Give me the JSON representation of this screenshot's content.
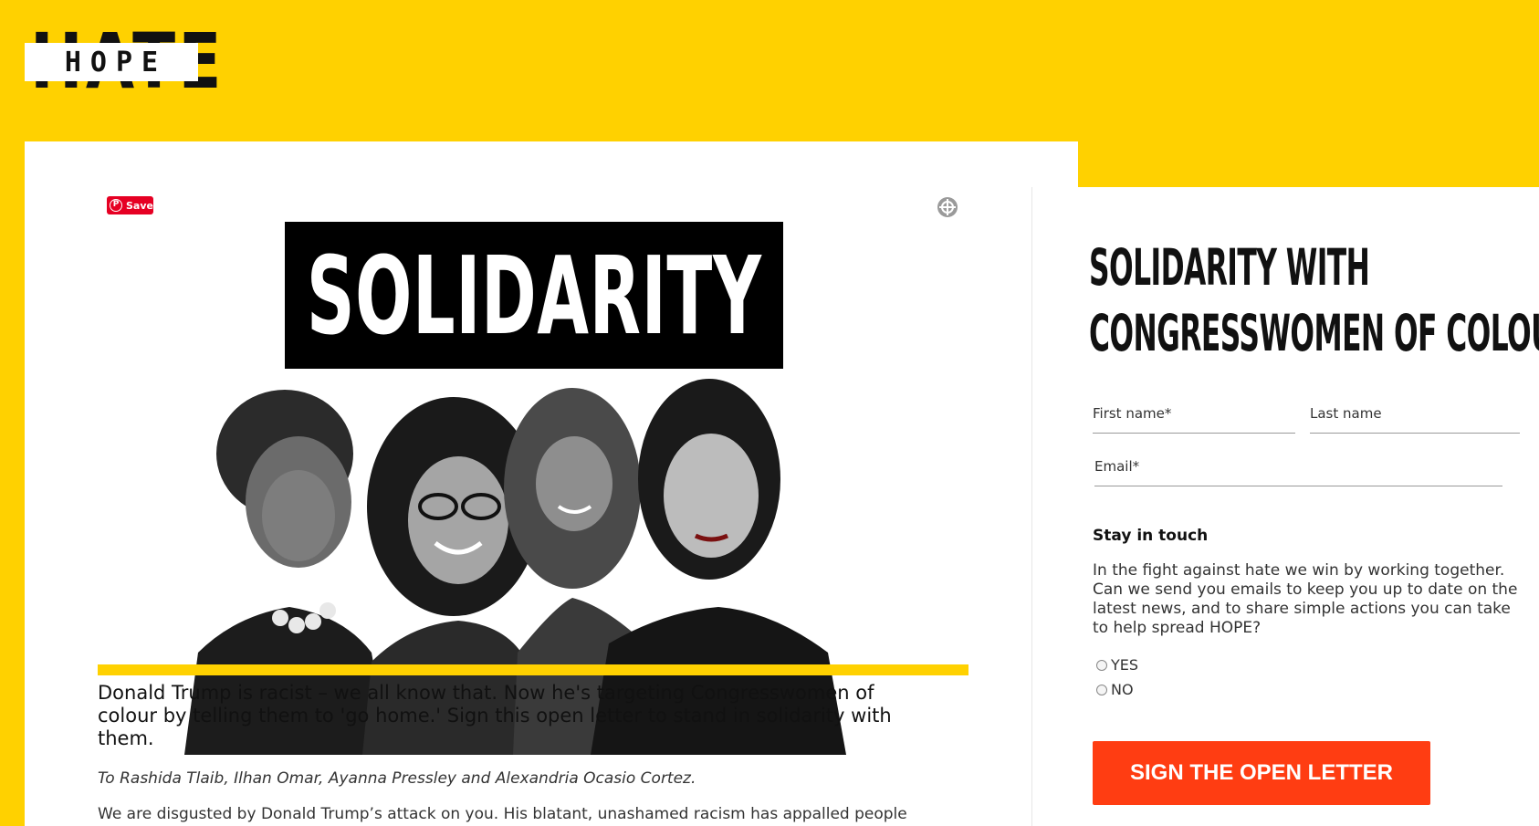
{
  "header": {
    "logo_word_back": "HATE",
    "logo_word_front": "HOPE"
  },
  "article": {
    "pinterest_label": "Save",
    "banner_text": "SOLIDARITY",
    "lead": "Donald Trump is racist – we all know that. Now he's targeting Congresswomen of colour by telling them to 'go home.' Sign this open letter to stand in solidarity with them.",
    "salutation": "To Rashida Tlaib, Ilhan Omar, Ayanna Pressley and Alexandria Ocasio Cortez.",
    "body": "We are disgusted by Donald Trump’s attack on you. His blatant, unashamed racism has appalled people"
  },
  "form": {
    "title_line1": "SOLIDARITY WITH",
    "title_line2": "CONGRESSWOMEN OF COLOUR",
    "first_name_label": "First name*",
    "last_name_label": "Last name",
    "email_label": "Email*",
    "stay_title": "Stay in touch",
    "stay_text": "In the fight against hate we win by working together. Can we send you emails to keep you up to date on the latest news, and to share simple actions you can take to help spread HOPE?",
    "options": [
      "YES",
      "NO"
    ],
    "submit_label": "SIGN THE OPEN LETTER"
  },
  "colors": {
    "brand_yellow": "#FFD100",
    "button_orange": "#FF3D12",
    "pinterest_red": "#E60023"
  }
}
